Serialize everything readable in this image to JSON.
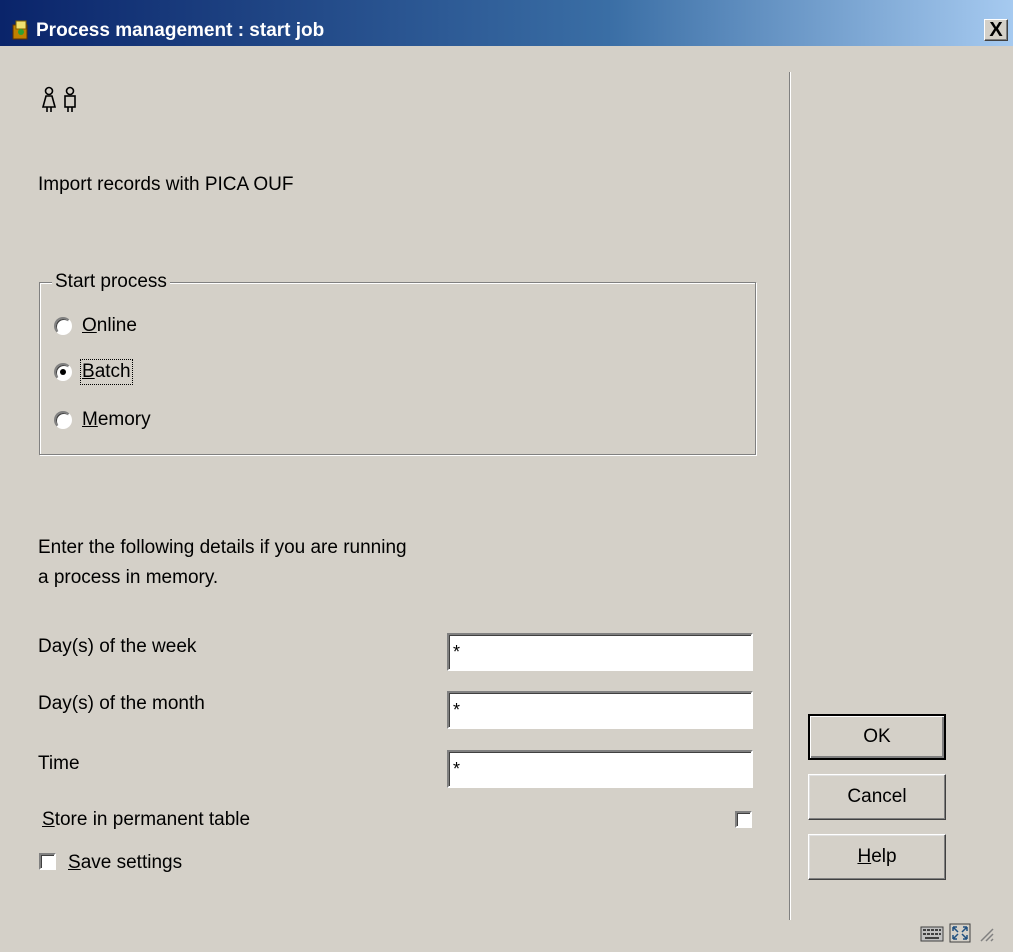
{
  "window": {
    "title": "Process management : start job",
    "close_glyph": "X"
  },
  "heading": {
    "description": "Import records with PICA OUF"
  },
  "start_process": {
    "legend": "Start process",
    "options": [
      {
        "label": "Online",
        "mnemonic": "O",
        "rest": "nline",
        "checked": false
      },
      {
        "label": "Batch",
        "mnemonic": "B",
        "rest": "atch",
        "checked": true
      },
      {
        "label": "Memory",
        "mnemonic": "M",
        "rest": "emory",
        "checked": false
      }
    ]
  },
  "memory_details": {
    "instruction_line1": "Enter the following details if you are running",
    "instruction_line2": "a process in memory.",
    "fields": [
      {
        "label": "Day(s) of the week",
        "value": "*"
      },
      {
        "label": "Day(s) of the month",
        "value": "*"
      },
      {
        "label": "Time",
        "value": "*"
      }
    ],
    "store_permanent": {
      "mnemonic": "S",
      "rest": "tore in permanent table",
      "checked": false
    },
    "save_settings": {
      "mnemonic": "S",
      "rest": "ave settings",
      "checked": false
    }
  },
  "buttons": {
    "ok": "OK",
    "cancel": "Cancel",
    "help_mnemonic": "H",
    "help_rest": "elp"
  },
  "icons": {
    "title": "app-icon",
    "people": "people-icon",
    "status": [
      "keyboard-icon",
      "maximize-icon",
      "resize-grip-icon"
    ]
  }
}
